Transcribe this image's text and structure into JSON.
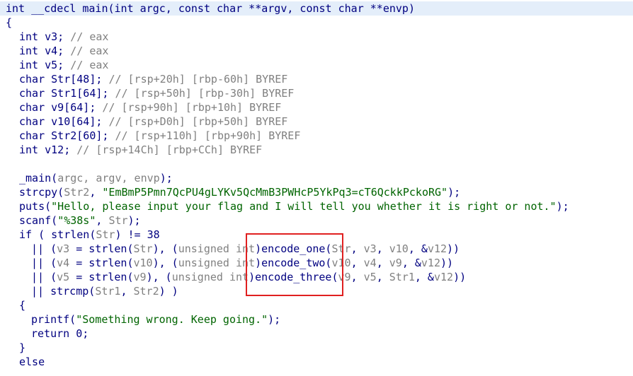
{
  "lines": [
    {
      "x": 8,
      "segs": [
        {
          "c": "k",
          "t": "int __cdecl main(int argc, const char **argv, const char **envp)"
        }
      ]
    },
    {
      "x": 8,
      "segs": [
        {
          "c": "k",
          "t": "{"
        }
      ]
    },
    {
      "x": 27,
      "segs": [
        {
          "c": "k",
          "t": "int v3; "
        },
        {
          "c": "cm",
          "t": "// eax"
        }
      ]
    },
    {
      "x": 27,
      "segs": [
        {
          "c": "k",
          "t": "int v4; "
        },
        {
          "c": "cm",
          "t": "// eax"
        }
      ]
    },
    {
      "x": 27,
      "segs": [
        {
          "c": "k",
          "t": "int v5; "
        },
        {
          "c": "cm",
          "t": "// eax"
        }
      ]
    },
    {
      "x": 27,
      "segs": [
        {
          "c": "k",
          "t": "char Str[48]; "
        },
        {
          "c": "cm",
          "t": "// [rsp+20h] [rbp-60h] BYREF"
        }
      ]
    },
    {
      "x": 27,
      "segs": [
        {
          "c": "k",
          "t": "char Str1[64]; "
        },
        {
          "c": "cm",
          "t": "// [rsp+50h] [rbp-30h] BYREF"
        }
      ]
    },
    {
      "x": 27,
      "segs": [
        {
          "c": "k",
          "t": "char v9[64]; "
        },
        {
          "c": "cm",
          "t": "// [rsp+90h] [rbp+10h] BYREF"
        }
      ]
    },
    {
      "x": 27,
      "segs": [
        {
          "c": "k",
          "t": "char v10[64]; "
        },
        {
          "c": "cm",
          "t": "// [rsp+D0h] [rbp+50h] BYREF"
        }
      ]
    },
    {
      "x": 27,
      "segs": [
        {
          "c": "k",
          "t": "char Str2[60]; "
        },
        {
          "c": "cm",
          "t": "// [rsp+110h] [rbp+90h] BYREF"
        }
      ]
    },
    {
      "x": 27,
      "segs": [
        {
          "c": "k",
          "t": "int v12; "
        },
        {
          "c": "cm",
          "t": "// [rsp+14Ch] [rbp+CCh] BYREF"
        }
      ]
    },
    {
      "x": 27,
      "segs": []
    },
    {
      "x": 27,
      "segs": [
        {
          "c": "fn",
          "t": "_main("
        },
        {
          "c": "cm",
          "t": "argc, argv, envp"
        },
        {
          "c": "fn",
          "t": ");"
        }
      ]
    },
    {
      "x": 27,
      "segs": [
        {
          "c": "fn",
          "t": "strcpy("
        },
        {
          "c": "cm",
          "t": "Str2"
        },
        {
          "c": "fn",
          "t": ", "
        },
        {
          "c": "s",
          "t": "\"EmBmP5Pmn7QcPU4gLYKv5QcMmB3PWHcP5YkPq3=cT6QckkPckoRG\""
        },
        {
          "c": "fn",
          "t": ");"
        }
      ]
    },
    {
      "x": 27,
      "segs": [
        {
          "c": "fn",
          "t": "puts("
        },
        {
          "c": "s",
          "t": "\"Hello, please input your flag and I will tell you whether it is right or not.\""
        },
        {
          "c": "fn",
          "t": ");"
        }
      ]
    },
    {
      "x": 27,
      "segs": [
        {
          "c": "fn",
          "t": "scanf("
        },
        {
          "c": "s",
          "t": "\"%38s\""
        },
        {
          "c": "fn",
          "t": ", "
        },
        {
          "c": "cm",
          "t": "Str"
        },
        {
          "c": "fn",
          "t": ");"
        }
      ]
    },
    {
      "x": 27,
      "segs": [
        {
          "c": "k",
          "t": "if ( strlen("
        },
        {
          "c": "cm",
          "t": "Str"
        },
        {
          "c": "k",
          "t": ") != 38"
        }
      ]
    },
    {
      "x": 44,
      "segs": [
        {
          "c": "k",
          "t": "|| ("
        },
        {
          "c": "cm",
          "t": "v3"
        },
        {
          "c": "k",
          "t": " = strlen("
        },
        {
          "c": "cm",
          "t": "Str"
        },
        {
          "c": "k",
          "t": "), ("
        },
        {
          "c": "ty",
          "t": "unsigned int"
        },
        {
          "c": "k",
          "t": ")encode_one("
        },
        {
          "c": "cm",
          "t": "Str"
        },
        {
          "c": "k",
          "t": ", "
        },
        {
          "c": "cm",
          "t": "v3"
        },
        {
          "c": "k",
          "t": ", "
        },
        {
          "c": "cm",
          "t": "v10"
        },
        {
          "c": "k",
          "t": ", &"
        },
        {
          "c": "cm",
          "t": "v12"
        },
        {
          "c": "k",
          "t": "))"
        }
      ]
    },
    {
      "x": 44,
      "segs": [
        {
          "c": "k",
          "t": "|| ("
        },
        {
          "c": "cm",
          "t": "v4"
        },
        {
          "c": "k",
          "t": " = strlen("
        },
        {
          "c": "cm",
          "t": "v10"
        },
        {
          "c": "k",
          "t": "), ("
        },
        {
          "c": "ty",
          "t": "unsigned int"
        },
        {
          "c": "k",
          "t": ")encode_two("
        },
        {
          "c": "cm",
          "t": "v10"
        },
        {
          "c": "k",
          "t": ", "
        },
        {
          "c": "cm",
          "t": "v4"
        },
        {
          "c": "k",
          "t": ", "
        },
        {
          "c": "cm",
          "t": "v9"
        },
        {
          "c": "k",
          "t": ", &"
        },
        {
          "c": "cm",
          "t": "v12"
        },
        {
          "c": "k",
          "t": "))"
        }
      ]
    },
    {
      "x": 44,
      "segs": [
        {
          "c": "k",
          "t": "|| ("
        },
        {
          "c": "cm",
          "t": "v5"
        },
        {
          "c": "k",
          "t": " = strlen("
        },
        {
          "c": "cm",
          "t": "v9"
        },
        {
          "c": "k",
          "t": "), ("
        },
        {
          "c": "ty",
          "t": "unsigned int"
        },
        {
          "c": "k",
          "t": ")encode_three("
        },
        {
          "c": "cm",
          "t": "v9"
        },
        {
          "c": "k",
          "t": ", "
        },
        {
          "c": "cm",
          "t": "v5"
        },
        {
          "c": "k",
          "t": ", "
        },
        {
          "c": "cm",
          "t": "Str1"
        },
        {
          "c": "k",
          "t": ", &"
        },
        {
          "c": "cm",
          "t": "v12"
        },
        {
          "c": "k",
          "t": "))"
        }
      ]
    },
    {
      "x": 44,
      "segs": [
        {
          "c": "k",
          "t": "|| strcmp("
        },
        {
          "c": "cm",
          "t": "Str1"
        },
        {
          "c": "k",
          "t": ", "
        },
        {
          "c": "cm",
          "t": "Str2"
        },
        {
          "c": "k",
          "t": ") )"
        }
      ]
    },
    {
      "x": 27,
      "segs": [
        {
          "c": "k",
          "t": "{"
        }
      ]
    },
    {
      "x": 44,
      "segs": [
        {
          "c": "fn",
          "t": "printf("
        },
        {
          "c": "s",
          "t": "\"Something wrong. Keep going.\""
        },
        {
          "c": "fn",
          "t": ");"
        }
      ]
    },
    {
      "x": 44,
      "segs": [
        {
          "c": "k",
          "t": "return 0;"
        }
      ]
    },
    {
      "x": 27,
      "segs": [
        {
          "c": "k",
          "t": "}"
        }
      ]
    },
    {
      "x": 27,
      "segs": [
        {
          "c": "k",
          "t": "else"
        }
      ]
    }
  ],
  "highlighted_line": 0
}
